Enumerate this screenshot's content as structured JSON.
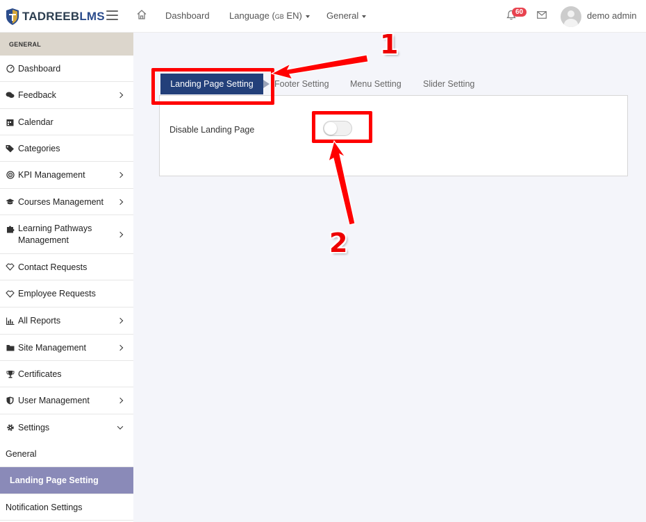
{
  "brand": {
    "name_part1": "TADREEB",
    "name_part2": "LMS"
  },
  "header": {
    "nav": [
      {
        "label": "Dashboard"
      },
      {
        "label": "Language (",
        "flag": "GB",
        "lang": " EN)"
      },
      {
        "label": "General"
      }
    ],
    "notification_count": "60",
    "user_name": "demo admin"
  },
  "sidebar": {
    "section": "GENERAL",
    "items": [
      {
        "label": "Dashboard",
        "icon": "gauge-icon"
      },
      {
        "label": "Feedback",
        "icon": "comments-icon"
      },
      {
        "label": "Calendar",
        "icon": "calendar-icon"
      },
      {
        "label": "Categories",
        "icon": "tags-icon"
      },
      {
        "label": "KPI Management",
        "icon": "target-icon"
      },
      {
        "label": "Courses Management",
        "icon": "graduation-cap-icon"
      },
      {
        "label": "Learning Pathways Management",
        "icon": "puzzle-icon"
      },
      {
        "label": "Contact Requests",
        "icon": "handshake-icon"
      },
      {
        "label": "Employee Requests",
        "icon": "handshake-icon"
      },
      {
        "label": "All Reports",
        "icon": "bar-chart-icon"
      },
      {
        "label": "Site Management",
        "icon": "folder-icon"
      },
      {
        "label": "Certificates",
        "icon": "trophy-icon"
      },
      {
        "label": "User Management",
        "icon": "shield-icon"
      },
      {
        "label": "Settings",
        "icon": "gear-icon"
      }
    ],
    "sub_items": [
      {
        "label": "General"
      },
      {
        "label": "Landing Page Setting"
      },
      {
        "label": "Notification Settings"
      }
    ]
  },
  "tabs": [
    {
      "label": "Landing Page Setting"
    },
    {
      "label": "Footer Setting"
    },
    {
      "label": "Menu Setting"
    },
    {
      "label": "Slider Setting"
    }
  ],
  "panel": {
    "label": "Disable Landing Page",
    "toggle_on": false
  },
  "annotations": {
    "one": "1",
    "two": "2"
  },
  "colors": {
    "accent": "#23407a",
    "active_sub": "#8a8ab8",
    "annotation": "#ff0000",
    "badge": "#e8434f"
  }
}
